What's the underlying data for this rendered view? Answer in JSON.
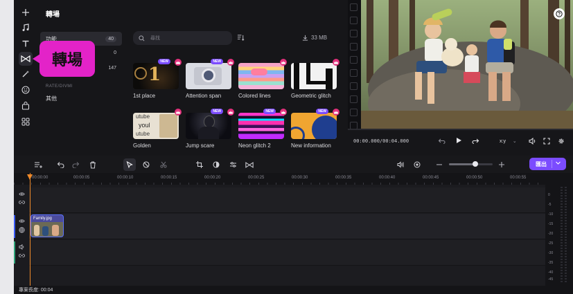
{
  "app": {
    "accent": "#7b4cff",
    "badge_color": "#e3307c",
    "tooltip_color": "#e323c8"
  },
  "toolbar": {
    "items": [
      {
        "icon": "plus-icon"
      },
      {
        "icon": "music-note-icon"
      },
      {
        "icon": "text-icon"
      },
      {
        "icon": "transition-icon",
        "active": true
      },
      {
        "icon": "effects-wand-icon"
      },
      {
        "icon": "sticker-smile-icon"
      },
      {
        "icon": "bag-icon"
      },
      {
        "icon": "apps-grid-icon"
      }
    ],
    "tooltip": "轉場"
  },
  "library": {
    "title": "轉場",
    "categories": [
      {
        "label": "功能",
        "count": "40"
      },
      {
        "label": "",
        "count": "0"
      },
      {
        "label": "",
        "count": "147"
      },
      {
        "label": "其他",
        "count": ""
      }
    ],
    "sub_label": "RATE/DIVMI",
    "search_placeholder": "尋找",
    "sort_icon": "sort-icon",
    "storage": "33 MB",
    "items": [
      {
        "label": "1st place",
        "new": true,
        "premium": true
      },
      {
        "label": "Attention span",
        "new": true,
        "premium": true
      },
      {
        "label": "Colored lines",
        "new": false,
        "premium": true
      },
      {
        "label": "Geometric glitch",
        "new": false,
        "premium": true
      },
      {
        "label": "Golden",
        "new": false,
        "premium": true
      },
      {
        "label": "Jump scare",
        "new": true,
        "premium": true
      },
      {
        "label": "Neon glitch 2",
        "new": true,
        "premium": true
      },
      {
        "label": "New information",
        "new": true,
        "premium": true
      }
    ],
    "thumb_texts": {
      "place": "1",
      "golden_1": "utube",
      "golden_2": "youl",
      "golden_3": "utube"
    },
    "new_badge": "NEW"
  },
  "preview": {
    "timecode": "00:00.000/00:04.000",
    "aspect": "x:y",
    "help_icon": "help-icon"
  },
  "edit_bar": {
    "export_label": "匯出"
  },
  "timeline": {
    "ticks": [
      "00:00:00",
      "00:00:05",
      "00:00:10",
      "00:00:15",
      "00:00:20",
      "00:00:25",
      "00:00:30",
      "00:00:35",
      "00:00:40",
      "00:00:45",
      "00:00:50",
      "00:00:55"
    ],
    "clip_label": "Family.jpg",
    "db_levels": [
      "0",
      "-5",
      "-10",
      "-15",
      "-20",
      "-25",
      "-30",
      "-35",
      "-40",
      "-45",
      "-50",
      "-60"
    ],
    "project_length": "專案長度: 00:04"
  }
}
